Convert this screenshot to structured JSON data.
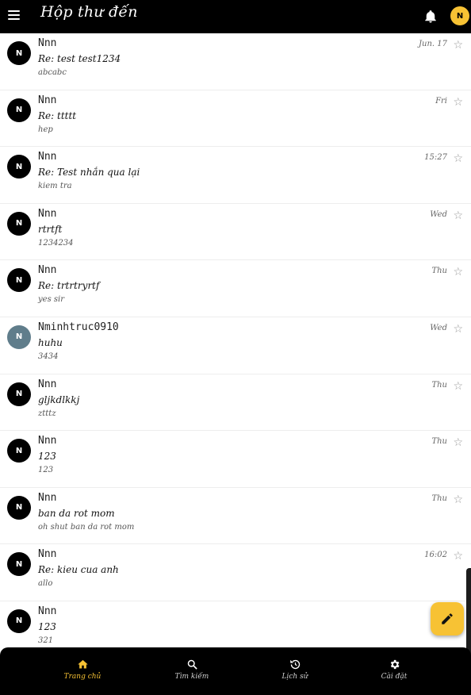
{
  "header": {
    "title": "Hộp thư đến",
    "avatar_initial": "N"
  },
  "emails": [
    {
      "avatar": "N",
      "sender": "Nnn",
      "subject": "Re: test test1234",
      "snippet": "abcabc",
      "date": "Jun. 17",
      "avatar_color": "#000000"
    },
    {
      "avatar": "N",
      "sender": "Nnn",
      "subject": "Re: ttttt",
      "snippet": "hep",
      "date": "Fri",
      "avatar_color": "#000000"
    },
    {
      "avatar": "N",
      "sender": "Nnn",
      "subject": "Re: Test nhắn qua lại",
      "snippet": "kiem tra",
      "date": "15:27",
      "avatar_color": "#000000"
    },
    {
      "avatar": "N",
      "sender": "Nnn",
      "subject": "rtrtft",
      "snippet": "1234234",
      "date": "Wed",
      "avatar_color": "#000000"
    },
    {
      "avatar": "N",
      "sender": "Nnn",
      "subject": "Re: trtrtryrtf",
      "snippet": "yes sir",
      "date": "Thu",
      "avatar_color": "#000000"
    },
    {
      "avatar": "N",
      "sender": "Nminhtruc0910",
      "subject": "huhu",
      "snippet": "3434",
      "date": "Wed",
      "avatar_color": "#607d8b"
    },
    {
      "avatar": "N",
      "sender": "Nnn",
      "subject": "gljkdlkkj",
      "snippet": "ztttz",
      "date": "Thu",
      "avatar_color": "#000000"
    },
    {
      "avatar": "N",
      "sender": "Nnn",
      "subject": "123",
      "snippet": "123",
      "date": "Thu",
      "avatar_color": "#000000"
    },
    {
      "avatar": "N",
      "sender": "Nnn",
      "subject": "ban da rot mom",
      "snippet": "oh shut ban da rot mom",
      "date": "Thu",
      "avatar_color": "#000000"
    },
    {
      "avatar": "N",
      "sender": "Nnn",
      "subject": "Re: kieu cua anh",
      "snippet": "allo",
      "date": "16:02",
      "avatar_color": "#000000"
    },
    {
      "avatar": "N",
      "sender": "Nnn",
      "subject": "123",
      "snippet": "321",
      "date": "",
      "avatar_color": "#000000"
    }
  ],
  "bottom_nav": [
    {
      "label": "Trang chủ",
      "icon": "home-icon",
      "active": true
    },
    {
      "label": "Tìm kiếm",
      "icon": "search-icon",
      "active": false
    },
    {
      "label": "Lịch sử",
      "icon": "history-icon",
      "active": false
    },
    {
      "label": "Cài đặt",
      "icon": "settings-icon",
      "active": false
    }
  ],
  "colors": {
    "accent": "#f7c234",
    "bar": "#000000",
    "star": "#9a9a9a"
  },
  "icons": {
    "menu": "menu-icon",
    "notifications": "bell-icon",
    "compose": "pencil-icon",
    "star": "star-outline-icon"
  }
}
